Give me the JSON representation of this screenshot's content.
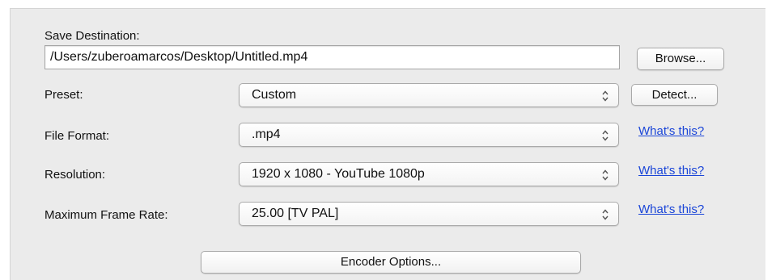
{
  "save_destination": {
    "label": "Save Destination:",
    "path": "/Users/zuberoamarcos/Desktop/Untitled.mp4",
    "browse_label": "Browse..."
  },
  "preset": {
    "label": "Preset:",
    "value": "Custom",
    "detect_label": "Detect..."
  },
  "file_format": {
    "label": "File Format:",
    "value": ".mp4",
    "help_link": "What's this?"
  },
  "resolution": {
    "label": "Resolution:",
    "value": "1920 x 1080 - YouTube 1080p",
    "help_link": "What's this?"
  },
  "frame_rate": {
    "label": "Maximum Frame Rate:",
    "value": "25.00 [TV PAL]",
    "help_link": "What's this?"
  },
  "encoder_options_label": "Encoder Options...",
  "colors": {
    "panel_background": "#ebebeb",
    "link": "#1a45d8"
  },
  "icons": {
    "popup_arrows": "popup-arrows-icon"
  }
}
